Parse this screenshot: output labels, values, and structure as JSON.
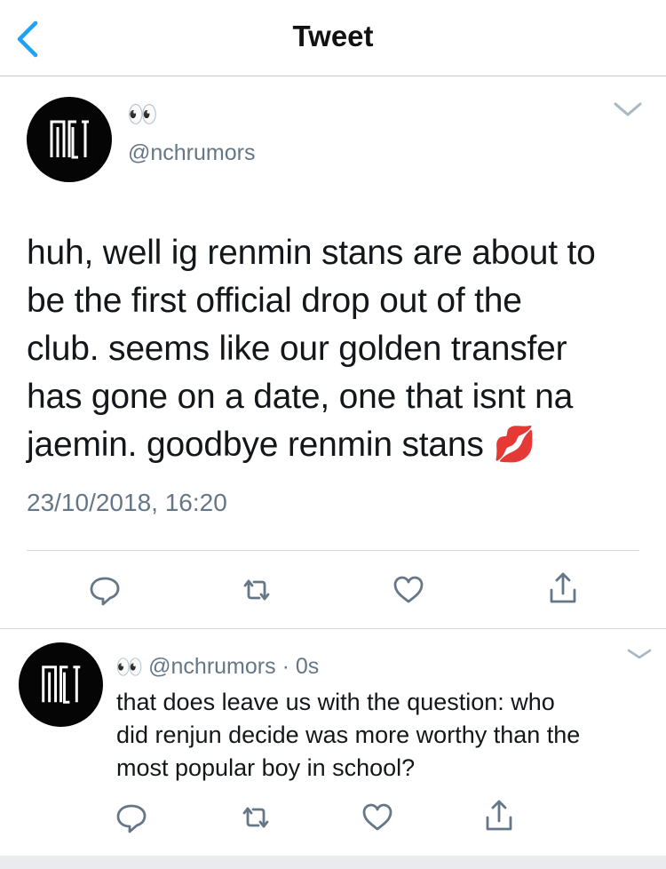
{
  "nav": {
    "title": "Tweet"
  },
  "main_tweet": {
    "display_name": "👀",
    "handle": "@nchrumors",
    "text_lines": [
      "huh, well ig renmin stans are about to",
      "be the first official drop out of the",
      "club. seems like our golden transfer",
      "has gone on a date, one that isnt na",
      "jaemin. goodbye renmin stans 💋"
    ],
    "timestamp": "23/10/2018, 16:20"
  },
  "reply_tweet": {
    "display_name": "👀",
    "handle": "@nchrumors",
    "separator": "·",
    "time": "0s",
    "text_lines": [
      "that does leave us with the question: who",
      "did renjun decide was more worthy than the",
      "most popular boy in school?"
    ]
  },
  "colors": {
    "accent": "#1da1f2",
    "secondary_text": "#657786",
    "icon_gray": "#657786",
    "divider": "#d8d8dc"
  },
  "icons": [
    "chevron-left-icon",
    "chevron-down-icon",
    "reply-icon",
    "retweet-icon",
    "like-icon",
    "share-icon",
    "avatar-logo"
  ]
}
